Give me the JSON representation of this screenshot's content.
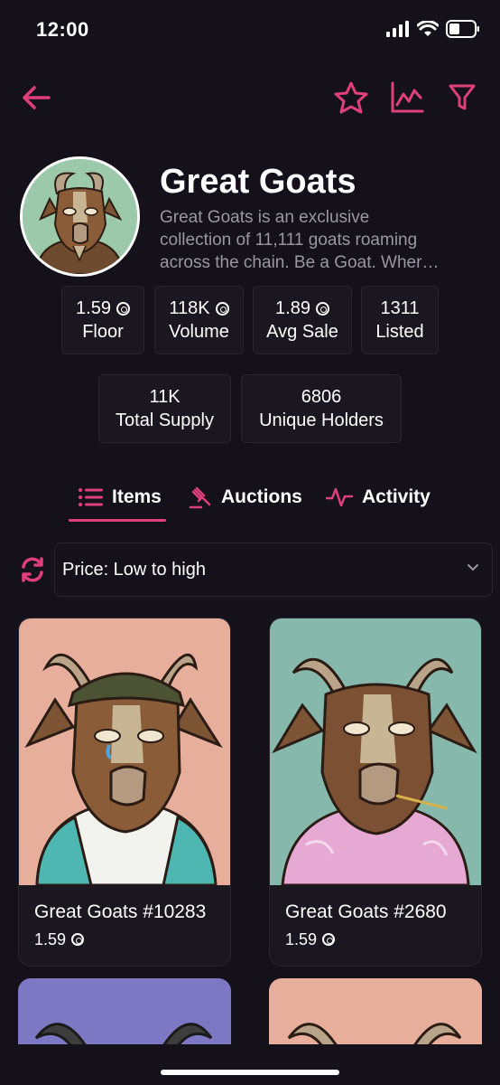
{
  "status_bar": {
    "time": "12:00"
  },
  "nav": {
    "back_icon": "arrow-left-icon",
    "actions": [
      "star-icon",
      "chart-icon",
      "filter-icon"
    ]
  },
  "collection": {
    "name": "Great Goats",
    "description_lines": [
      "Great Goats is an exclusive",
      "collection of 11,111 goats roaming",
      "across the chain. Be a Goat. Wher…"
    ]
  },
  "stats": [
    {
      "value": "1.59",
      "label": "Floor",
      "currency": true
    },
    {
      "value": "118K",
      "label": "Volume",
      "currency": true
    },
    {
      "value": "1.89",
      "label": "Avg Sale",
      "currency": true
    },
    {
      "value": "1311",
      "label": "Listed",
      "currency": false
    },
    {
      "value": "11K",
      "label": "Total Supply",
      "currency": false
    },
    {
      "value": "6806",
      "label": "Unique Holders",
      "currency": false
    }
  ],
  "tabs": [
    {
      "label": "Items",
      "icon": "list-icon",
      "active": true
    },
    {
      "label": "Auctions",
      "icon": "gavel-icon",
      "active": false
    },
    {
      "label": "Activity",
      "icon": "pulse-icon",
      "active": false
    }
  ],
  "sort": {
    "selected": "Price: Low to high"
  },
  "items": [
    {
      "name": "Great Goats #10283",
      "price": "1.59",
      "bg": "#e8ae9c"
    },
    {
      "name": "Great Goats #2680",
      "price": "1.59",
      "bg": "#86b8ac"
    },
    {
      "name": "",
      "price": "",
      "bg": "#7d78c4"
    },
    {
      "name": "",
      "price": "",
      "bg": "#e8ae9c"
    }
  ],
  "colors": {
    "accent": "#e0407a",
    "background": "#15111a",
    "card": "#1b1721",
    "muted": "#9a96a3"
  }
}
